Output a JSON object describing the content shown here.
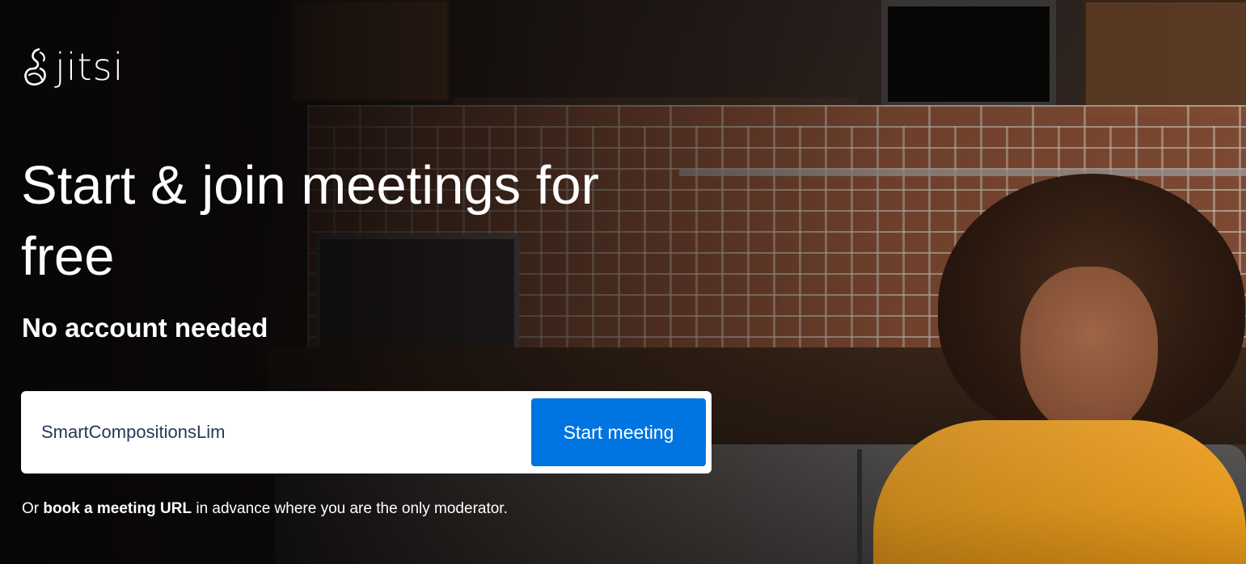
{
  "brand": {
    "name": "jitsi",
    "logo_icon": "jitsi-logo-icon"
  },
  "hero": {
    "headline": "Start & join meetings for free",
    "subheadline": "No account needed"
  },
  "join_form": {
    "room_name_value": "SmartCompositionsLim",
    "start_button_label": "Start meeting"
  },
  "book_meeting": {
    "prefix": "Or ",
    "link_label": "book a meeting URL",
    "suffix": " in advance where you are the only moderator."
  },
  "colors": {
    "button_blue": "#0074e0",
    "text_white": "#ffffff",
    "input_text": "#253858"
  }
}
